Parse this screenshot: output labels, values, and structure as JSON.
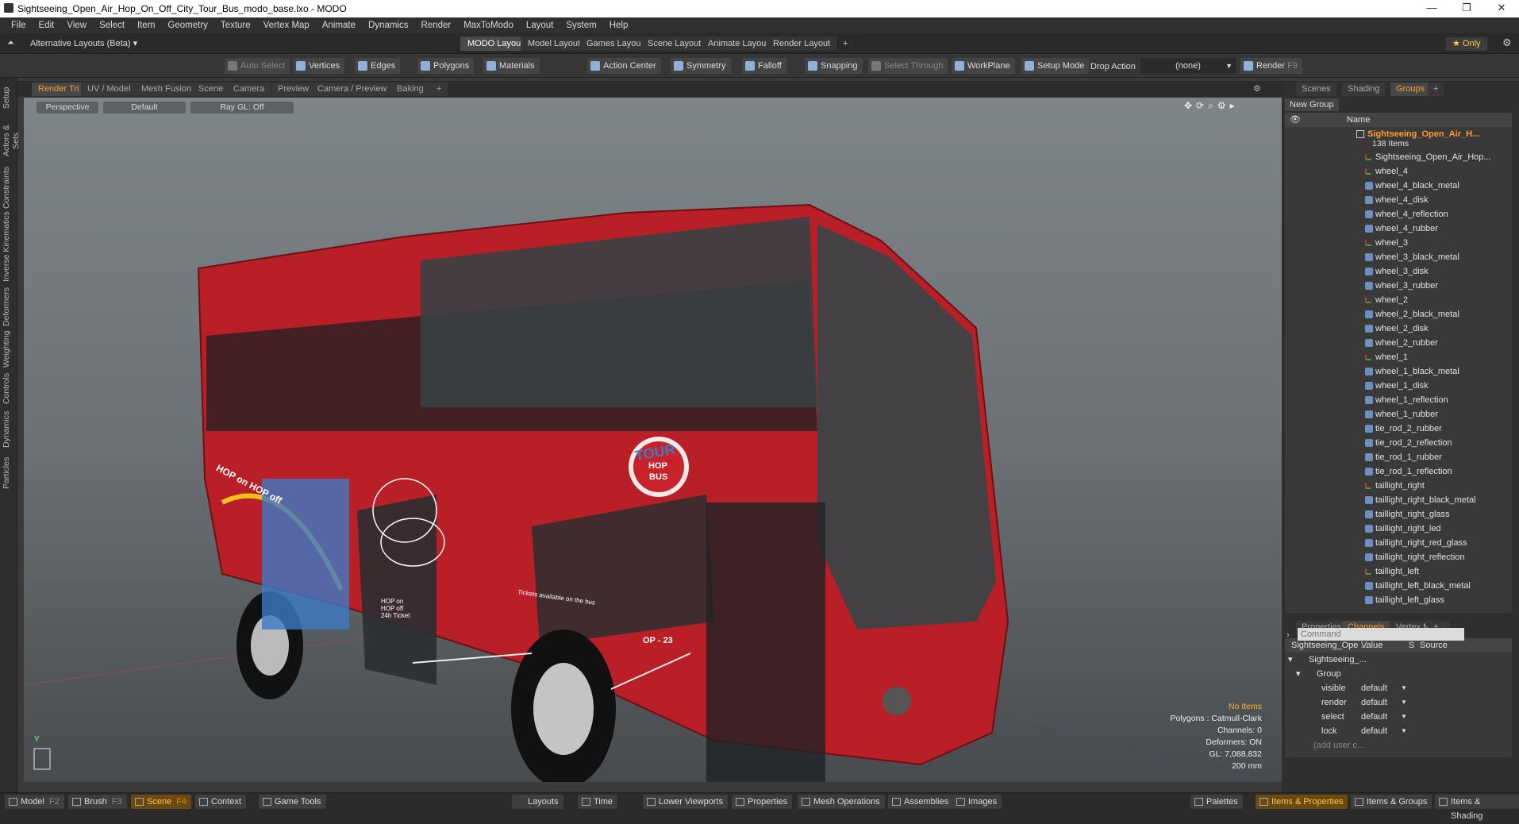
{
  "window": {
    "title": "Sightseeing_Open_Air_Hop_On_Off_City_Tour_Bus_modo_base.lxo - MODO",
    "minimize": "—",
    "restore": "❐",
    "close": "✕"
  },
  "menu": [
    "File",
    "Edit",
    "View",
    "Select",
    "Item",
    "Geometry",
    "Texture",
    "Vertex Map",
    "Animate",
    "Dynamics",
    "Render",
    "MaxToModo",
    "Layout",
    "System",
    "Help"
  ],
  "layouts": {
    "selector": "Alternative Layouts (Beta) ▾",
    "tabs": [
      "MODO Layout",
      "Model Layout",
      "Games Layout",
      "Scene Layout",
      "Animate Layout",
      "Render Layout"
    ],
    "add": "+",
    "only": "★ Only"
  },
  "toolbar": {
    "auto_select": "Auto Select",
    "vertices": "Vertices",
    "edges": "Edges",
    "polygons": "Polygons",
    "materials": "Materials",
    "action_center": "Action Center",
    "symmetry": "Symmetry",
    "falloff": "Falloff",
    "snapping": "Snapping",
    "select_through": "Select Through",
    "workplane": "WorkPlane",
    "setup_mode": "Setup Mode",
    "drop_action": "Drop Action",
    "drop_value": "(none)",
    "render": "Render",
    "render_key": "F9"
  },
  "left_tabs": [
    "Setup",
    "Actors & Sets",
    "Constraints",
    "Inverse Kinematics",
    "Deformers",
    "Weighting",
    "Controls",
    "Dynamics",
    "Particles"
  ],
  "viewport_tabs": [
    "Render Tri",
    "UV / Model",
    "Mesh Fusion",
    "Scene",
    "Camera",
    "Preview",
    "Camera / Preview",
    "Baking",
    "+"
  ],
  "viewport": {
    "perspective": "Perspective",
    "default": "Default",
    "raygl": "Ray GL: Off",
    "info": {
      "no_items": "No Items",
      "polygons": "Polygons : Catmull-Clark",
      "channels": "Channels: 0",
      "deformers": "Deformers: ON",
      "gl": "GL: 7,088,832",
      "scale": "200 mm"
    },
    "axis_y": "Y",
    "bus": {
      "tour": "TOUR",
      "hop": "HOP",
      "bus_word": "BUS",
      "hop_on_off": "HOP on HOP off",
      "tickets": "Tickets available on the bus",
      "op": "OP - 23",
      "door_sign": "HOP on HOP off 24h Ticket"
    }
  },
  "right_tabs": [
    "Scenes",
    "Shading",
    "Groups",
    "+"
  ],
  "groups": {
    "new_group": "New Group",
    "name_header": "Name",
    "root": "Sightseeing_Open_Air_H...",
    "count": "138 Items",
    "items": [
      "Sightseeing_Open_Air_Hop...",
      "wheel_4",
      "wheel_4_black_metal",
      "wheel_4_disk",
      "wheel_4_reflection",
      "wheel_4_rubber",
      "wheel_3",
      "wheel_3_black_metal",
      "wheel_3_disk",
      "wheel_3_rubber",
      "wheel_2",
      "wheel_2_black_metal",
      "wheel_2_disk",
      "wheel_2_rubber",
      "wheel_1",
      "wheel_1_black_metal",
      "wheel_1_disk",
      "wheel_1_reflection",
      "wheel_1_rubber",
      "tie_rod_2_rubber",
      "tie_rod_2_reflection",
      "tie_rod_1_rubber",
      "tie_rod_1_reflection",
      "taillight_right",
      "taillight_right_black_metal",
      "taillight_right_glass",
      "taillight_right_led",
      "taillight_right_red_glass",
      "taillight_right_reflection",
      "taillight_left",
      "taillight_left_black_metal",
      "taillight_left_glass"
    ]
  },
  "channel_tabs": [
    "Properties",
    "Channels",
    "Vertex Maps",
    "+"
  ],
  "channels": {
    "headers": [
      "Sightseeing_Ope ...",
      "Value",
      "S",
      "Source"
    ],
    "item": "Sightseeing_...",
    "group": "Group",
    "rows": [
      {
        "name": "visible",
        "value": "default"
      },
      {
        "name": "render",
        "value": "default"
      },
      {
        "name": "select",
        "value": "default"
      },
      {
        "name": "lock",
        "value": "default"
      }
    ],
    "add": "(add user c..."
  },
  "command_placeholder": "Command",
  "status": {
    "model": "Model",
    "model_key": "F2",
    "brush": "Brush",
    "brush_key": "F3",
    "scene": "Scene",
    "scene_key": "F4",
    "context": "Context",
    "game_tools": "Game Tools",
    "layouts": "Layouts",
    "time": "Time",
    "lower_viewports": "Lower Viewports",
    "properties": "Properties",
    "mesh_operations": "Mesh Operations",
    "assemblies": "Assemblies",
    "images": "Images",
    "palettes": "Palettes",
    "items_properties": "Items & Properties",
    "items_groups": "Items & Groups",
    "items_shading": "Items & Shading"
  },
  "colors": {
    "accent": "#ff9d2e",
    "bus_red": "#c8232a"
  }
}
